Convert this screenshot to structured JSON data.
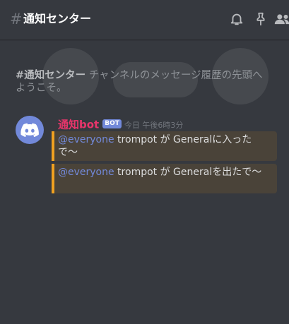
{
  "header": {
    "hash_symbol": "#",
    "channel_name": "通知センター",
    "icons": [
      "bell-icon",
      "pin-icon",
      "members-icon"
    ]
  },
  "welcome": {
    "channel_ref": "#通知センター",
    "text": " チャンネルのメッセージ履歴の先頭へようこそ。"
  },
  "message_group": {
    "author": "通知bot",
    "bot_tag": "BOT",
    "timestamp": "今日 午後6時3分",
    "author_color": "#e8356b",
    "messages": [
      {
        "mention": "@everyone",
        "text": " trompot が Generalに入ったで〜"
      },
      {
        "mention": "@everyone",
        "text": " trompot が Generalを出たで〜"
      }
    ]
  },
  "colors": {
    "background": "#36393f",
    "accent": "#7289da",
    "embed_border": "#f0a020"
  }
}
